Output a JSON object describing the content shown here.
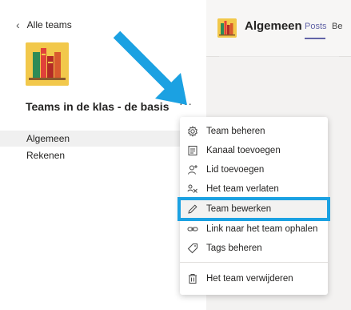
{
  "sidebar": {
    "back_label": "Alle teams",
    "team_name": "Teams in de klas - de basis",
    "more_label": "···",
    "channels": [
      {
        "label": "Algemeen",
        "active": true
      },
      {
        "label": "Rekenen",
        "active": false
      }
    ]
  },
  "main": {
    "channel_title": "Algemeen",
    "tabs": [
      {
        "label": "Posts",
        "active": true
      },
      {
        "label": "Be",
        "active": false
      }
    ]
  },
  "menu": {
    "items": [
      {
        "label": "Team beheren",
        "icon": "gear-icon"
      },
      {
        "label": "Kanaal toevoegen",
        "icon": "channel-add-icon"
      },
      {
        "label": "Lid toevoegen",
        "icon": "add-member-icon"
      },
      {
        "label": "Het team verlaten",
        "icon": "leave-team-icon"
      },
      {
        "label": "Team bewerken",
        "icon": "pencil-icon",
        "highlighted": true
      },
      {
        "label": "Link naar het team ophalen",
        "icon": "link-icon"
      },
      {
        "label": "Tags beheren",
        "icon": "tag-icon"
      },
      {
        "label": "Het team verwijderen",
        "icon": "trash-icon"
      }
    ]
  },
  "colors": {
    "accent": "#6264a7",
    "highlight_outline": "#1ba1e2",
    "pointer_arrow": "#1ba1e2",
    "team_avatar_bg": "#f2c84b"
  }
}
